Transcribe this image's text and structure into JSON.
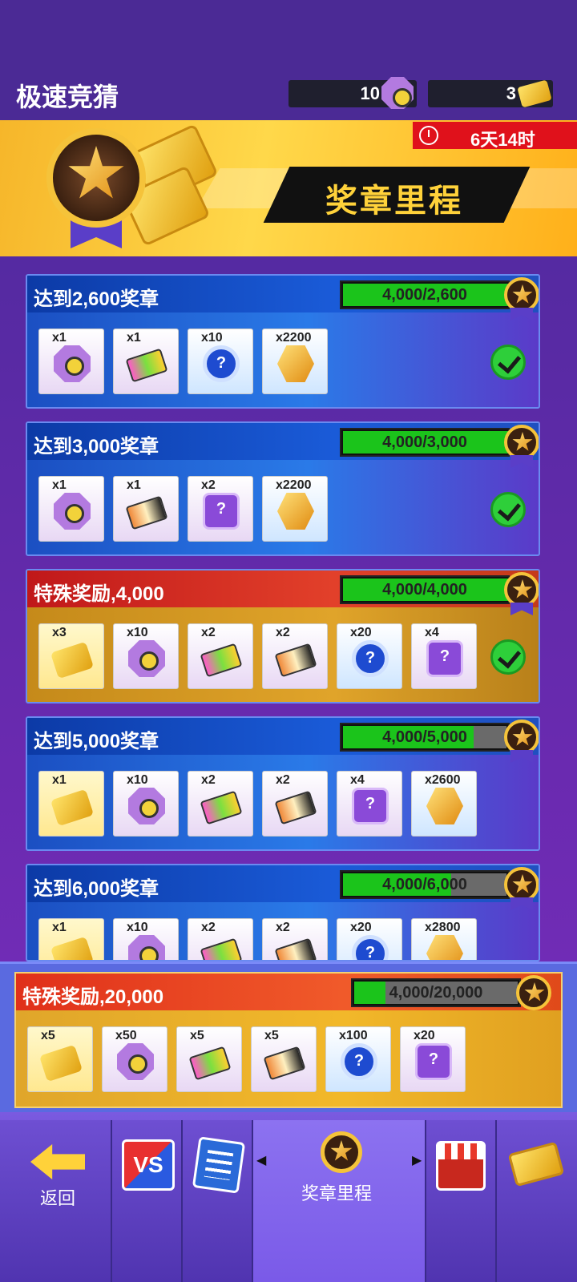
{
  "header": {
    "title": "极速竞猜",
    "gems": "10",
    "tickets": "3"
  },
  "banner": {
    "timer": "6天14时",
    "title": "奖章里程"
  },
  "tiers": [
    {
      "title": "达到2,600奖章",
      "progress_text": "4,000/2,600",
      "progress": 1.0,
      "claimed": true,
      "rewards": [
        {
          "qty": "x1",
          "icon": "gem-icon"
        },
        {
          "qty": "x1",
          "icon": "card-neon-icon"
        },
        {
          "qty": "x10",
          "icon": "mystery-coin-icon"
        },
        {
          "qty": "x2200",
          "icon": "gold-hex-icon"
        }
      ]
    },
    {
      "title": "达到3,000奖章",
      "progress_text": "4,000/3,000",
      "progress": 1.0,
      "claimed": true,
      "rewards": [
        {
          "qty": "x1",
          "icon": "gem-icon"
        },
        {
          "qty": "x1",
          "icon": "card-orange-icon"
        },
        {
          "qty": "x2",
          "icon": "mystery-box-icon"
        },
        {
          "qty": "x2200",
          "icon": "gold-hex-icon"
        }
      ]
    },
    {
      "title": "特殊奖励,4,000",
      "progress_text": "4,000/4,000",
      "progress": 1.0,
      "claimed": true,
      "rewards": [
        {
          "qty": "x3",
          "icon": "ticket-icon"
        },
        {
          "qty": "x10",
          "icon": "gem-icon"
        },
        {
          "qty": "x2",
          "icon": "card-neon-icon"
        },
        {
          "qty": "x2",
          "icon": "card-orange-icon"
        },
        {
          "qty": "x20",
          "icon": "mystery-coin-icon"
        },
        {
          "qty": "x4",
          "icon": "mystery-box-icon"
        }
      ]
    },
    {
      "title": "达到5,000奖章",
      "progress_text": "4,000/5,000",
      "progress": 0.8,
      "claimed": false,
      "rewards": [
        {
          "qty": "x1",
          "icon": "ticket-icon"
        },
        {
          "qty": "x10",
          "icon": "gem-icon"
        },
        {
          "qty": "x2",
          "icon": "card-neon-icon"
        },
        {
          "qty": "x2",
          "icon": "card-orange-icon"
        },
        {
          "qty": "x4",
          "icon": "mystery-box-icon"
        },
        {
          "qty": "x2600",
          "icon": "gold-hex-icon"
        }
      ]
    },
    {
      "title": "达到6,000奖章",
      "progress_text": "4,000/6,000",
      "progress": 0.667,
      "claimed": false,
      "rewards": [
        {
          "qty": "x1",
          "icon": "ticket-icon"
        },
        {
          "qty": "x10",
          "icon": "gem-icon"
        },
        {
          "qty": "x2",
          "icon": "card-neon-icon"
        },
        {
          "qty": "x2",
          "icon": "card-orange-icon"
        },
        {
          "qty": "x20",
          "icon": "mystery-coin-icon"
        },
        {
          "qty": "x2800",
          "icon": "gold-hex-icon"
        }
      ]
    }
  ],
  "final_reward": {
    "title": "特殊奖励,20,000",
    "progress_text": "4,000/20,000",
    "progress": 0.2,
    "rewards": [
      {
        "qty": "x5",
        "icon": "ticket-icon"
      },
      {
        "qty": "x50",
        "icon": "gem-icon"
      },
      {
        "qty": "x5",
        "icon": "card-neon-icon"
      },
      {
        "qty": "x5",
        "icon": "card-orange-icon"
      },
      {
        "qty": "x100",
        "icon": "mystery-coin-icon"
      },
      {
        "qty": "x20",
        "icon": "mystery-box-icon"
      }
    ]
  },
  "nav": {
    "back_label": "返回",
    "vs_label": "VS",
    "active_label": "奖章里程"
  }
}
